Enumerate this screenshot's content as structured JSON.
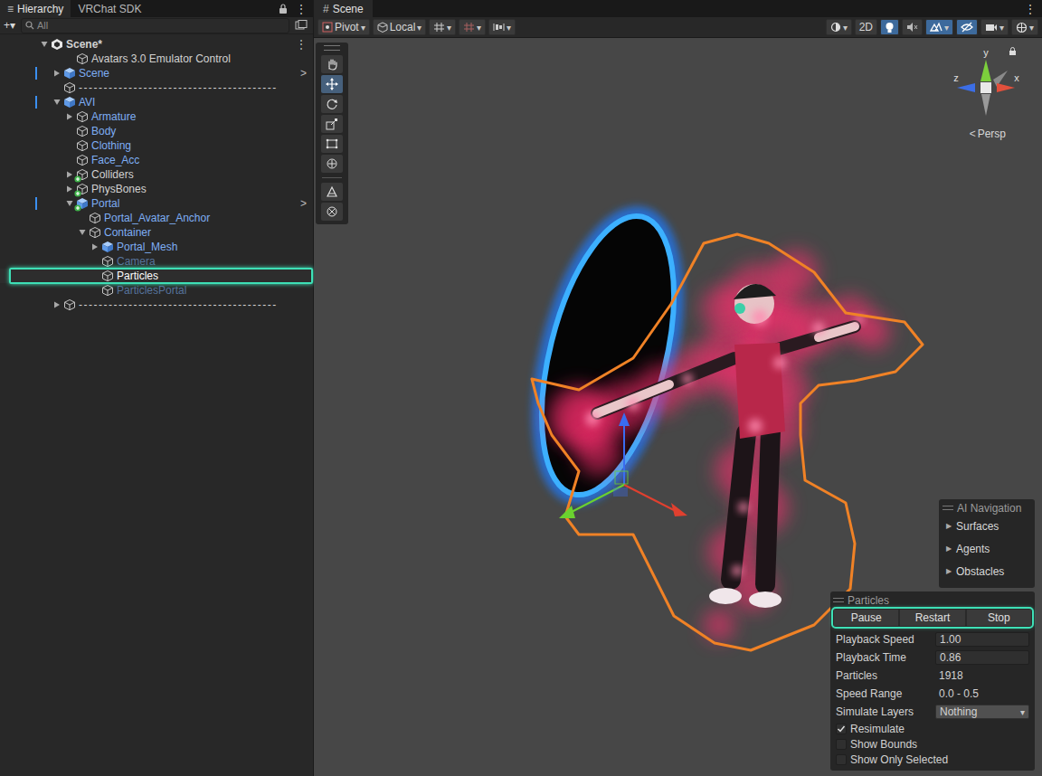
{
  "left_tabs": [
    {
      "label": "Hierarchy",
      "selected": true
    },
    {
      "label": "VRChat SDK",
      "selected": false
    }
  ],
  "left_tab_icon": "≡",
  "left_menu": "⋮",
  "hierarchy": {
    "add_button": "+▾",
    "search_placeholder": "All",
    "rows": [
      {
        "label": "Scene*",
        "indent": 0,
        "kind": "scene",
        "prefab": false,
        "badge": false,
        "expandable": true,
        "expanded": true,
        "disabled": false,
        "selected": false,
        "modified": false,
        "trailing": "⋮"
      },
      {
        "label": "Avatars 3.0 Emulator Control",
        "indent": 2,
        "kind": "object",
        "prefab": false,
        "badge": false,
        "expandable": false,
        "expanded": false,
        "disabled": false,
        "selected": false,
        "modified": false,
        "trailing": ""
      },
      {
        "label": "Scene",
        "indent": 1,
        "kind": "prefab",
        "prefab": true,
        "badge": false,
        "expandable": true,
        "expanded": false,
        "disabled": false,
        "selected": false,
        "modified": true,
        "trailing": ">"
      },
      {
        "label": "----------------------------------------",
        "indent": 1,
        "kind": "separator",
        "prefab": false,
        "badge": false,
        "expandable": false,
        "expanded": false,
        "disabled": false,
        "selected": false,
        "modified": false,
        "trailing": ""
      },
      {
        "label": "AVI",
        "indent": 1,
        "kind": "prefab",
        "prefab": true,
        "badge": false,
        "expandable": true,
        "expanded": true,
        "disabled": false,
        "selected": false,
        "modified": true,
        "trailing": ""
      },
      {
        "label": "Armature",
        "indent": 2,
        "kind": "object",
        "prefab": true,
        "badge": false,
        "expandable": true,
        "expanded": false,
        "disabled": false,
        "selected": false,
        "modified": false,
        "trailing": ""
      },
      {
        "label": "Body",
        "indent": 2,
        "kind": "object",
        "prefab": true,
        "badge": false,
        "expandable": false,
        "expanded": false,
        "disabled": false,
        "selected": false,
        "modified": false,
        "trailing": ""
      },
      {
        "label": "Clothing",
        "indent": 2,
        "kind": "object",
        "prefab": true,
        "badge": false,
        "expandable": false,
        "expanded": false,
        "disabled": false,
        "selected": false,
        "modified": false,
        "trailing": ""
      },
      {
        "label": "Face_Acc",
        "indent": 2,
        "kind": "object",
        "prefab": true,
        "badge": false,
        "expandable": false,
        "expanded": false,
        "disabled": false,
        "selected": false,
        "modified": false,
        "trailing": ""
      },
      {
        "label": "Colliders",
        "indent": 2,
        "kind": "object",
        "prefab": false,
        "badge": true,
        "expandable": true,
        "expanded": false,
        "disabled": false,
        "selected": false,
        "modified": false,
        "trailing": ""
      },
      {
        "label": "PhysBones",
        "indent": 2,
        "kind": "object",
        "prefab": false,
        "badge": true,
        "expandable": true,
        "expanded": false,
        "disabled": false,
        "selected": false,
        "modified": false,
        "trailing": ""
      },
      {
        "label": "Portal",
        "indent": 2,
        "kind": "prefab",
        "prefab": true,
        "badge": true,
        "expandable": true,
        "expanded": true,
        "disabled": false,
        "selected": false,
        "modified": true,
        "trailing": ">"
      },
      {
        "label": "Portal_Avatar_Anchor",
        "indent": 3,
        "kind": "object",
        "prefab": true,
        "badge": false,
        "expandable": false,
        "expanded": false,
        "disabled": false,
        "selected": false,
        "modified": false,
        "trailing": ""
      },
      {
        "label": "Container",
        "indent": 3,
        "kind": "object",
        "prefab": true,
        "badge": false,
        "expandable": true,
        "expanded": true,
        "disabled": false,
        "selected": false,
        "modified": false,
        "trailing": ""
      },
      {
        "label": "Portal_Mesh",
        "indent": 4,
        "kind": "prefab",
        "prefab": true,
        "badge": false,
        "expandable": true,
        "expanded": false,
        "disabled": false,
        "selected": false,
        "modified": false,
        "trailing": ""
      },
      {
        "label": "Camera",
        "indent": 4,
        "kind": "object",
        "prefab": true,
        "badge": false,
        "expandable": false,
        "expanded": false,
        "disabled": true,
        "selected": false,
        "modified": false,
        "trailing": ""
      },
      {
        "label": "Particles",
        "indent": 4,
        "kind": "object",
        "prefab": false,
        "badge": false,
        "expandable": false,
        "expanded": false,
        "disabled": false,
        "selected": true,
        "modified": false,
        "trailing": ""
      },
      {
        "label": "ParticlesPortal",
        "indent": 4,
        "kind": "object",
        "prefab": true,
        "badge": false,
        "expandable": false,
        "expanded": false,
        "disabled": true,
        "selected": false,
        "modified": false,
        "trailing": ""
      },
      {
        "label": "----------------------------------------",
        "indent": 1,
        "kind": "separator",
        "prefab": false,
        "badge": false,
        "expandable": true,
        "expanded": false,
        "disabled": false,
        "selected": false,
        "modified": false,
        "trailing": ""
      }
    ]
  },
  "scene_tab": {
    "icon": "#",
    "label": "Scene",
    "selected": true
  },
  "scene_toolbar": {
    "left": [
      {
        "kind": "pivot",
        "label": "Pivot",
        "arrow": "▾"
      },
      {
        "kind": "local",
        "label": "Local",
        "arrow": "▾"
      },
      {
        "kind": "grid",
        "label": "",
        "arrow": "▾"
      },
      {
        "kind": "snap",
        "label": "",
        "arrow": "▾"
      },
      {
        "kind": "align",
        "label": "",
        "arrow": "▾"
      }
    ],
    "right": [
      {
        "kind": "shading",
        "label": "",
        "arrow": "▾",
        "on": false
      },
      {
        "kind": "mode2d",
        "label": "2D",
        "arrow": "",
        "on": false
      },
      {
        "kind": "lighting",
        "label": "",
        "arrow": "",
        "on": true
      },
      {
        "kind": "audio",
        "label": "",
        "arrow": "",
        "on": false
      },
      {
        "kind": "effects",
        "label": "",
        "arrow": "▾",
        "on": true
      },
      {
        "kind": "visibility",
        "label": "",
        "arrow": "",
        "on": true
      },
      {
        "kind": "camera",
        "label": "",
        "arrow": "▾",
        "on": false
      },
      {
        "kind": "gizmos",
        "label": "",
        "arrow": "▾",
        "on": false
      }
    ]
  },
  "tools": [
    {
      "kind": "hand",
      "group": "main",
      "selected": false
    },
    {
      "kind": "move",
      "group": "main",
      "selected": true
    },
    {
      "kind": "rotate",
      "group": "main",
      "selected": false
    },
    {
      "kind": "scale",
      "group": "main",
      "selected": false
    },
    {
      "kind": "rect",
      "group": "main",
      "selected": false
    },
    {
      "kind": "transform",
      "group": "main",
      "selected": false
    },
    {
      "kind": "editor",
      "group": "extra",
      "selected": false
    },
    {
      "kind": "custom",
      "group": "extra",
      "selected": false
    }
  ],
  "orientation": {
    "y": "y",
    "z": "z",
    "x": "x",
    "projection_icon": "<",
    "projection": "Persp"
  },
  "ai_navigation": {
    "title": "AI Navigation",
    "items": [
      {
        "arrow": "▶",
        "label": "Surfaces",
        "expanded": false
      },
      {
        "arrow": "▶",
        "label": "Agents",
        "expanded": false
      },
      {
        "arrow": "▶",
        "label": "Obstacles",
        "expanded": false
      }
    ]
  },
  "particles_panel": {
    "title": "Particles",
    "buttons": [
      {
        "label": "Pause"
      },
      {
        "label": "Restart"
      },
      {
        "label": "Stop"
      }
    ],
    "buttons_highlighted": true,
    "fields": [
      {
        "label": "Playback Speed",
        "value": "1.00",
        "kind": "input",
        "arrow": ""
      },
      {
        "label": "Playback Time",
        "value": "0.86",
        "kind": "input",
        "arrow": ""
      },
      {
        "label": "Particles",
        "value": "1918",
        "kind": "text",
        "arrow": ""
      },
      {
        "label": "Speed Range",
        "value": "0.0 - 0.5",
        "kind": "text",
        "arrow": ""
      },
      {
        "label": "Simulate Layers",
        "value": "Nothing",
        "kind": "dropdown",
        "arrow": "▾"
      }
    ],
    "checks": [
      {
        "label": "Resimulate",
        "checked": true
      },
      {
        "label": "Show Bounds",
        "checked": false
      },
      {
        "label": "Show Only Selected",
        "checked": false
      }
    ]
  }
}
